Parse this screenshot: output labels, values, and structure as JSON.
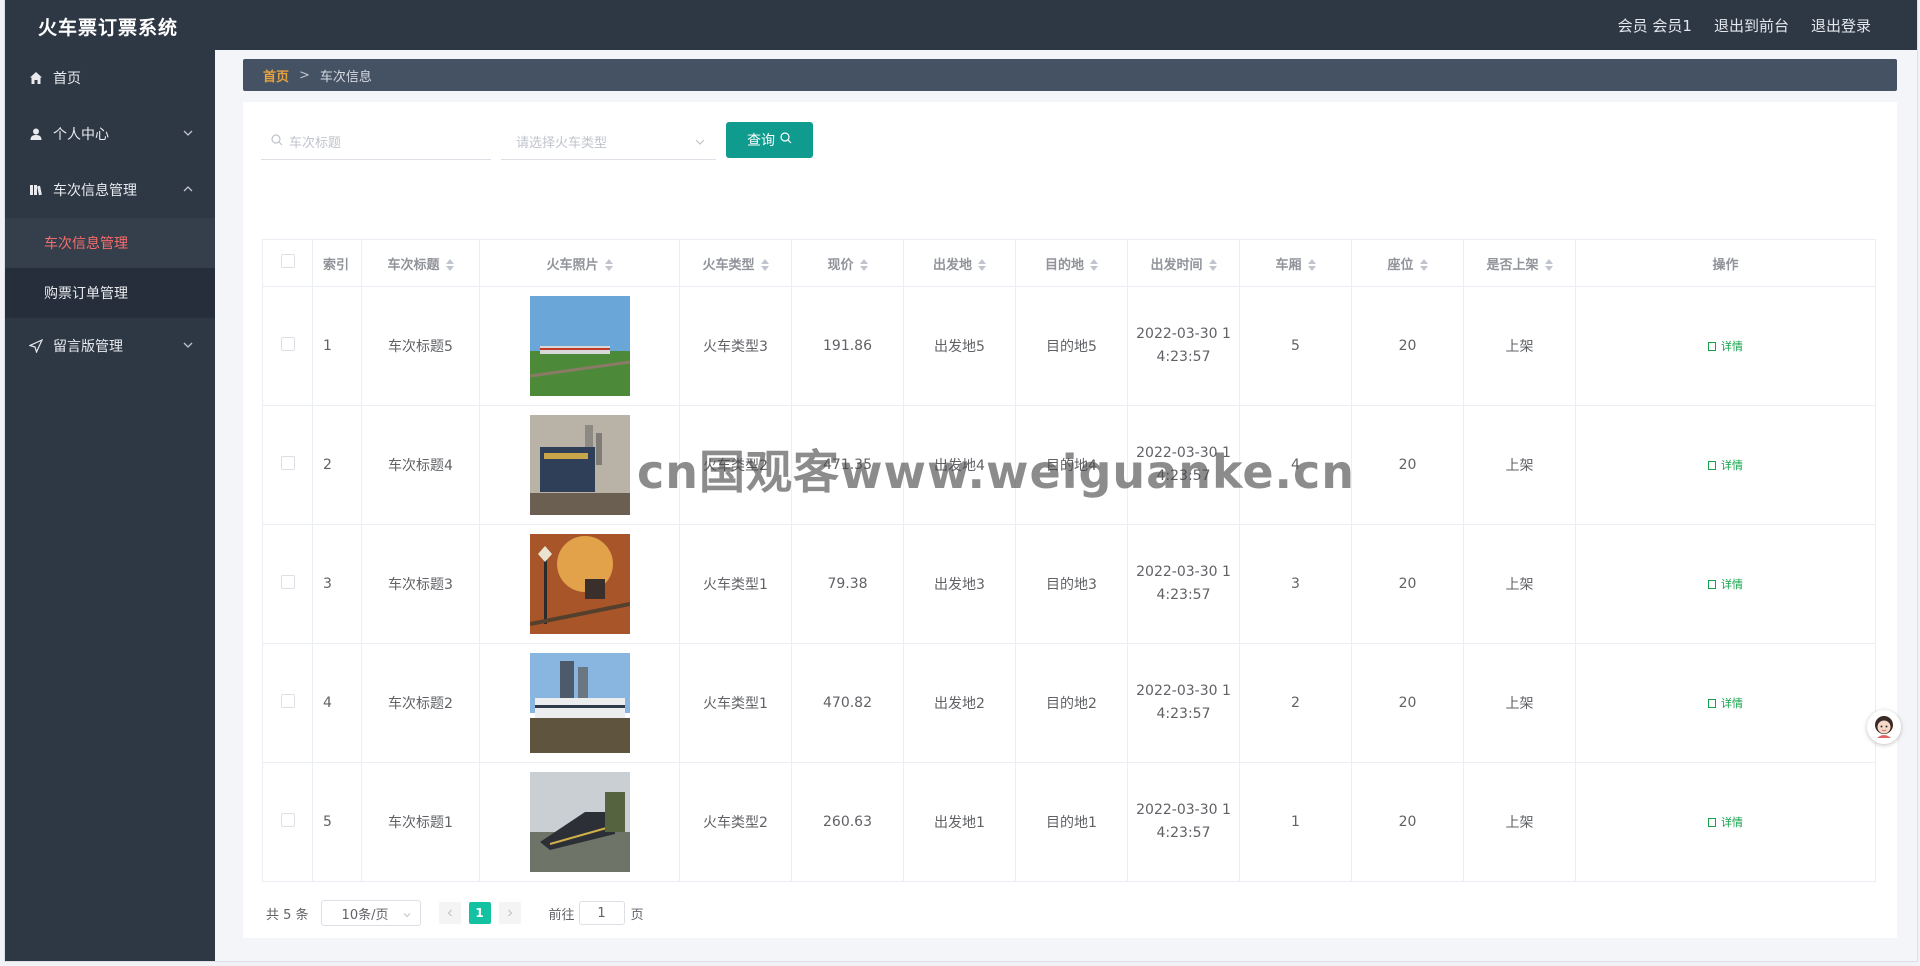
{
  "header": {
    "brand": "火车票订票系统",
    "user": "会员 会员1",
    "front_link": "退出到前台",
    "logout_link": "退出登录"
  },
  "sidebar": {
    "items": [
      {
        "label": "首页",
        "icon": "home-icon"
      },
      {
        "label": "个人中心",
        "icon": "user-icon"
      },
      {
        "label": "车次信息管理",
        "icon": "book-icon",
        "children": [
          "车次信息管理",
          "购票订单管理"
        ]
      },
      {
        "label": "留言版管理",
        "icon": "send-icon"
      }
    ],
    "active_sub": "车次信息管理"
  },
  "breadcrumb": {
    "home": "首页",
    "separator": ">",
    "current": "车次信息"
  },
  "search": {
    "title_placeholder": "车次标题",
    "type_placeholder": "请选择火车类型",
    "query_label": "查询"
  },
  "table": {
    "headers": [
      "索引",
      "车次标题",
      "火车照片",
      "火车类型",
      "现价",
      "出发地",
      "目的地",
      "出发时间",
      "车厢",
      "座位",
      "是否上架",
      "操作"
    ],
    "detail_label": "详情",
    "rows": [
      {
        "index": "1",
        "title": "车次标题5",
        "photo": "photo-blue-sky-train",
        "type": "火车类型3",
        "price": "191.86",
        "from": "出发地5",
        "to": "目的地5",
        "time_a": "2022-03-30 1",
        "time_b": "4:23:57",
        "carriage": "5",
        "seat": "20",
        "shelf": "上架"
      },
      {
        "index": "2",
        "title": "车次标题4",
        "photo": "photo-locomotive-city",
        "type": "火车类型2",
        "price": "471.35",
        "from": "出发地4",
        "to": "目的地4",
        "time_a": "2022-03-30 1",
        "time_b": "4:23:57",
        "carriage": "4",
        "seat": "20",
        "shelf": "上架"
      },
      {
        "index": "3",
        "title": "车次标题3",
        "photo": "photo-autumn-train",
        "type": "火车类型1",
        "price": "79.38",
        "from": "出发地3",
        "to": "目的地3",
        "time_a": "2022-03-30 1",
        "time_b": "4:23:57",
        "carriage": "3",
        "seat": "20",
        "shelf": "上架"
      },
      {
        "index": "4",
        "title": "车次标题2",
        "photo": "photo-white-train-city",
        "type": "火车类型1",
        "price": "470.82",
        "from": "出发地2",
        "to": "目的地2",
        "time_a": "2022-03-30 1",
        "time_b": "4:23:57",
        "carriage": "2",
        "seat": "20",
        "shelf": "上架"
      },
      {
        "index": "5",
        "title": "车次标题1",
        "photo": "photo-highspeed-train",
        "type": "火车类型2",
        "price": "260.63",
        "from": "出发地1",
        "to": "目的地1",
        "time_a": "2022-03-30 1",
        "time_b": "4:23:57",
        "carriage": "1",
        "seat": "20",
        "shelf": "上架"
      }
    ]
  },
  "pagination": {
    "total": "共 5 条",
    "page_size": "10条/页",
    "current_page": "1",
    "goto_label": "前往",
    "goto_value": "1",
    "page_suffix": "页"
  },
  "watermark": "cn国观客www.weiguanke.cn",
  "colors": {
    "header_bg": "#2e3845",
    "accent": "#0f9b8e",
    "active_menu": "#f56c6c",
    "breadcrumb_home": "#e6a23c",
    "detail_link": "#13a14a"
  }
}
